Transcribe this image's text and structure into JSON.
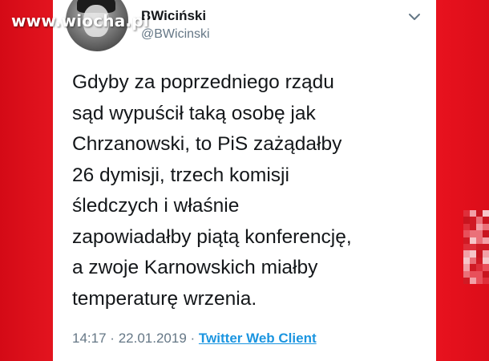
{
  "watermark": {
    "text": "www.wiocha.pl"
  },
  "tweet": {
    "display_name": "BWiciński",
    "handle": "@BWicinski",
    "menu_icon": "chevron-down-icon",
    "lines": [
      "Gdyby za poprzedniego rządu",
      "sąd wypuścił taką osobę jak",
      "Chrzanowski, to PiS zażądałby",
      "26 dymisji, trzech komisji",
      "śledczych i właśnie",
      "zapowiadałby piątą konferencję,",
      "a zwoje Karnowskich miałby",
      "temperaturę wrzenia."
    ],
    "time": "14:17",
    "date": "22.01.2019",
    "separator": "·",
    "client": "Twitter Web Client"
  },
  "colors": {
    "background_red": "#e0101c",
    "card": "#ffffff",
    "text": "#14171a",
    "muted": "#657786",
    "link": "#1b95e0"
  }
}
